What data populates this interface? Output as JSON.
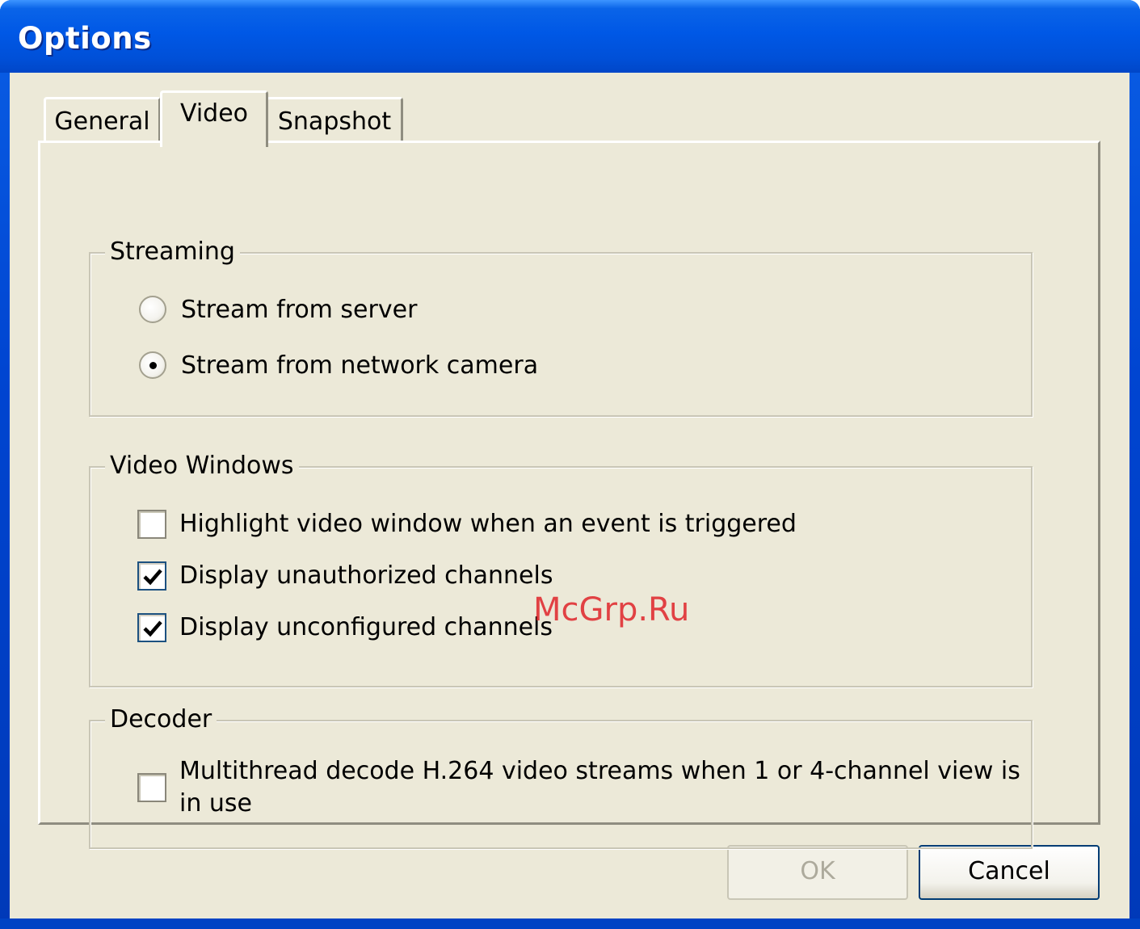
{
  "window": {
    "title": "Options"
  },
  "tabs": [
    {
      "label": "General",
      "selected": false
    },
    {
      "label": "Video",
      "selected": true
    },
    {
      "label": "Snapshot",
      "selected": false
    }
  ],
  "streaming": {
    "legend": "Streaming",
    "options": [
      {
        "label": "Stream from server",
        "selected": false
      },
      {
        "label": "Stream from network camera",
        "selected": true
      }
    ]
  },
  "video_windows": {
    "legend": "Video Windows",
    "options": [
      {
        "label": "Highlight video window when an event is triggered",
        "checked": false
      },
      {
        "label": "Display unauthorized channels",
        "checked": true
      },
      {
        "label": "Display unconfigured channels",
        "checked": true
      }
    ]
  },
  "decoder": {
    "legend": "Decoder",
    "options": [
      {
        "label_line1": "Multithread decode H.264 video streams when 1 or 4-channel view is",
        "label_line2": "in use",
        "checked": false
      }
    ]
  },
  "buttons": {
    "ok": {
      "label": "OK",
      "enabled": false
    },
    "cancel": {
      "label": "Cancel",
      "enabled": true
    }
  },
  "watermark": "McGrp.Ru",
  "colors": {
    "titlebar": "#0058e6",
    "client": "#ece9d8",
    "watermark": "#e0242a"
  }
}
